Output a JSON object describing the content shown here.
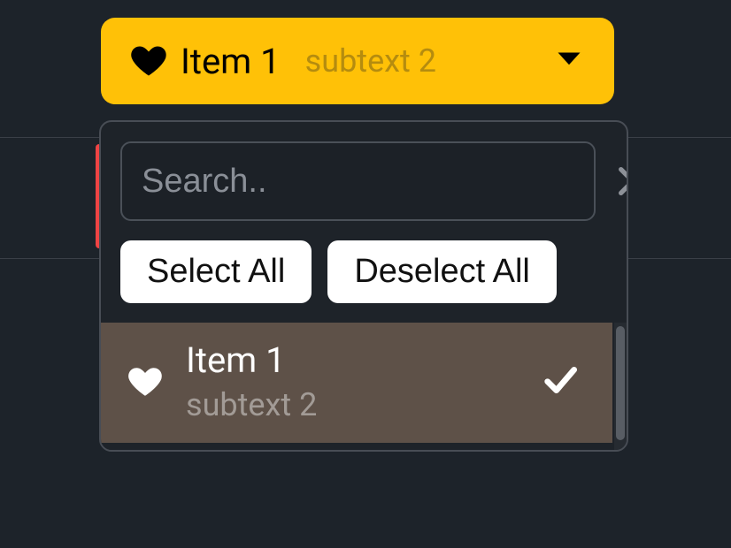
{
  "trigger": {
    "icon": "heart",
    "label": "Item 1",
    "subtext": "subtext 2"
  },
  "dropdown": {
    "search_placeholder": "Search..",
    "search_value": "",
    "select_all": "Select All",
    "deselect_all": "Deselect All",
    "options": [
      {
        "icon": "heart",
        "label": "Item 1",
        "subtext": "subtext 2",
        "selected": true
      }
    ]
  },
  "colors": {
    "accent": "#ffc107",
    "bg": "#1d232a",
    "option_selected_bg": "#5e5148"
  }
}
